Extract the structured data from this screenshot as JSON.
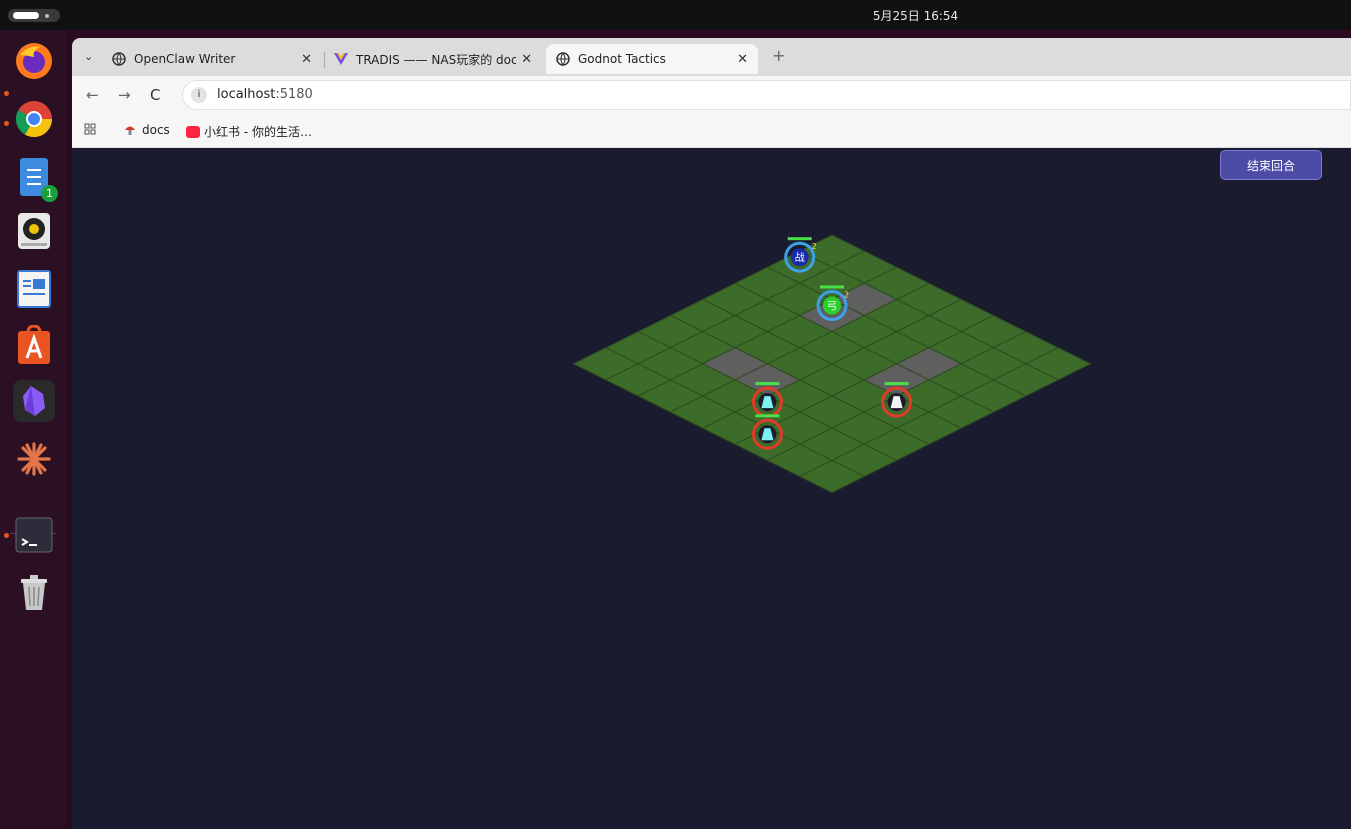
{
  "system": {
    "clock": "5月25日 16:54"
  },
  "dock": {
    "apps": [
      {
        "name": "firefox-icon",
        "running": true
      },
      {
        "name": "chrome-icon",
        "running": true
      },
      {
        "name": "text-editor-icon",
        "running": false,
        "badge": "1"
      },
      {
        "name": "rhythmbox-icon",
        "running": false
      },
      {
        "name": "writer-icon",
        "running": false
      },
      {
        "name": "app-center-icon",
        "running": false
      },
      {
        "name": "obsidian-icon",
        "running": false
      },
      {
        "name": "claude-icon",
        "running": false
      },
      {
        "name": "terminal-icon",
        "running": true
      },
      {
        "name": "trash-icon",
        "running": false
      }
    ],
    "badge_count": "1"
  },
  "browser": {
    "tabs": [
      {
        "label": "OpenClaw Writer",
        "icon": "globe-icon",
        "active": false
      },
      {
        "label": "TRADIS —— NAS玩家的 doc",
        "icon": "vue-icon",
        "active": false
      },
      {
        "label": "Godnot Tactics",
        "icon": "globe-icon",
        "active": true
      }
    ],
    "url_host": "localhost",
    "url_port": ":5180",
    "bookmarks": [
      {
        "label": "docs",
        "icon": "mushroom-icon"
      },
      {
        "label": "小红书 - 你的生活…",
        "icon": "xiaohongshu-icon"
      }
    ]
  },
  "game": {
    "end_turn_label": "结束回合",
    "grid_size": 8,
    "colors": {
      "tile": "#3d6b2a",
      "tile_line": "#2a4d1e",
      "obstacle": "#5f5f5f",
      "background": "#1b1b2f",
      "ally_ring": "#3da0e8",
      "enemy_ring": "#e03a2a",
      "hp_bar": "#4ae04a"
    },
    "obstacles": [
      [
        2,
        5
      ],
      [
        3,
        5
      ],
      [
        2,
        1
      ],
      [
        2,
        2
      ],
      [
        5,
        2
      ],
      [
        5,
        3
      ]
    ],
    "units": [
      {
        "team": "ally",
        "glyph": "战",
        "col": 0,
        "row": 1,
        "fill": "#1a2aa8",
        "level": "2"
      },
      {
        "team": "ally",
        "glyph": "弓",
        "col": 2,
        "row": 2,
        "fill": "#2ad12a",
        "level": "2"
      },
      {
        "team": "enemy",
        "glyph": "▲",
        "col": 4,
        "row": 6,
        "fill": "#7ef0f0"
      },
      {
        "team": "enemy",
        "glyph": "▲",
        "col": 5,
        "row": 7,
        "fill": "#7ef0f0"
      },
      {
        "team": "enemy",
        "glyph": "▲",
        "col": 6,
        "row": 4,
        "fill": "#f4f4f4"
      }
    ]
  }
}
